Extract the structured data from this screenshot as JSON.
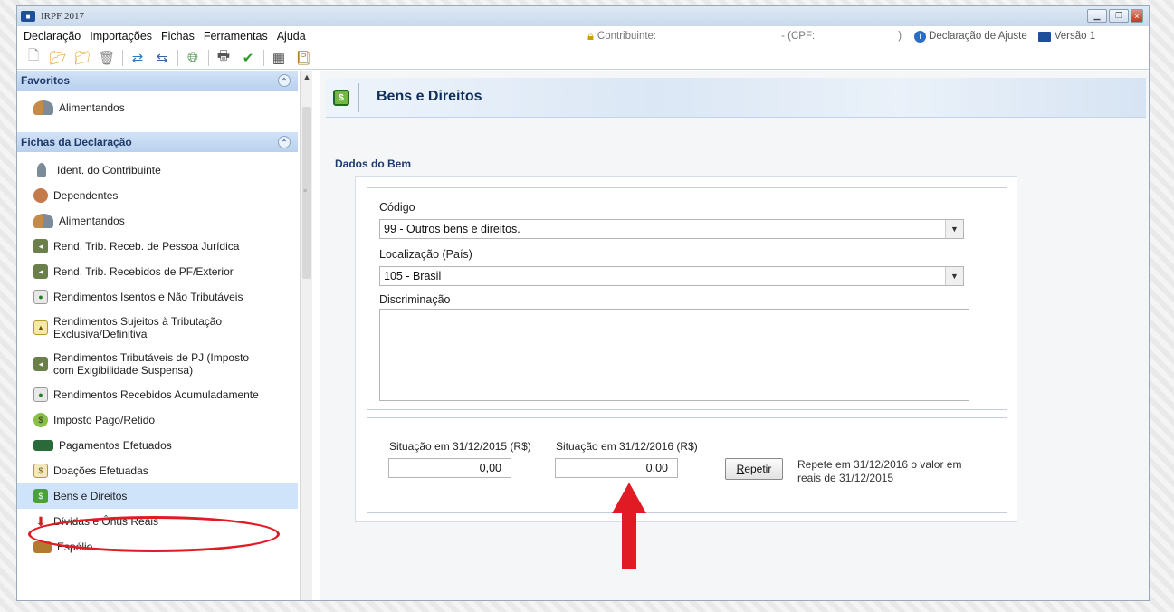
{
  "window": {
    "title": "IRPF 2017"
  },
  "menu": {
    "items": [
      "Declaração",
      "Importações",
      "Fichas",
      "Ferramentas",
      "Ajuda"
    ],
    "contribuinte_label": "Contribuinte:",
    "cpf_label": "- (CPF:",
    "close_paren": ")",
    "declaracao_label": "Declaração de Ajuste",
    "versao_label": "Versão 1"
  },
  "sidebar": {
    "favoritos_title": "Favoritos",
    "favoritos_items": [
      {
        "label": "Alimentandos",
        "icon": "people-icon"
      }
    ],
    "fichas_title": "Fichas da Declaração",
    "fichas_items": [
      {
        "label": "Ident. do Contribuinte",
        "icon": "person-icon"
      },
      {
        "label": "Dependentes",
        "icon": "kids-icon"
      },
      {
        "label": "Alimentandos",
        "icon": "people-icon"
      },
      {
        "label": "Rend. Trib. Receb. de Pessoa Jurídica",
        "icon": "arrow-bag-icon"
      },
      {
        "label": "Rend. Trib. Recebidos de PF/Exterior",
        "icon": "arrow-bag-icon"
      },
      {
        "label": "Rendimentos Isentos e Não Tributáveis",
        "icon": "doc-icon"
      },
      {
        "label": "Rendimentos Sujeitos à Tributação Exclusiva/Definitiva",
        "icon": "warn-icon"
      },
      {
        "label": "Rendimentos Tributáveis de PJ (Imposto com Exigibilidade Suspensa)",
        "icon": "arrow-bag-icon"
      },
      {
        "label": "Rendimentos Recebidos Acumuladamente",
        "icon": "doc-icon"
      },
      {
        "label": "Imposto Pago/Retido",
        "icon": "coin-icon"
      },
      {
        "label": "Pagamentos Efetuados",
        "icon": "card-icon"
      },
      {
        "label": "Doações Efetuadas",
        "icon": "gift-icon"
      },
      {
        "label": "Bens e Direitos",
        "icon": "money-icon"
      },
      {
        "label": "Dívidas e Ônus Reais",
        "icon": "red-arrow-icon"
      },
      {
        "label": "Espólio",
        "icon": "chest-icon"
      }
    ]
  },
  "main": {
    "title": "Bens e Direitos",
    "section_label": "Dados do Bem",
    "codigo_label": "Código",
    "codigo_value": "99 - Outros bens e direitos.",
    "localizacao_label": "Localização (País)",
    "localizacao_value": "105 - Brasil",
    "discriminacao_label": "Discriminação",
    "situacao_2015_label": "Situação em 31/12/2015 (R$)",
    "situacao_2015_value": "0,00",
    "situacao_2016_label": "Situação em 31/12/2016 (R$)",
    "situacao_2016_value": "0,00",
    "repetir_r": "R",
    "repetir_rest": "epetir",
    "repetir_desc": "Repete em 31/12/2016 o valor em reais de 31/12/2015"
  },
  "colors": {
    "accent": "#1e4f9b",
    "highlight": "#e01b24",
    "selected": "#cfe3fa"
  }
}
